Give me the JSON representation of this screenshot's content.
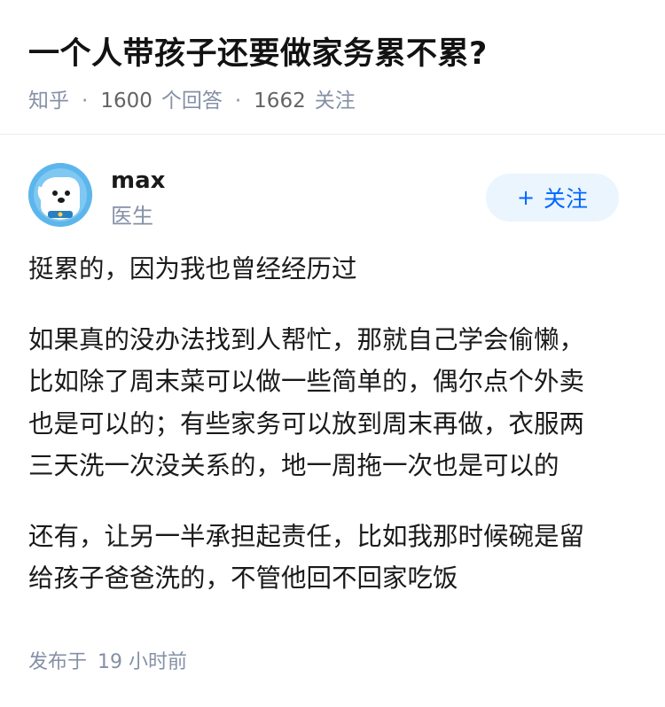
{
  "question": {
    "title": "一个人带孩子还要做家务累不累?",
    "source": "知乎",
    "separator": "·",
    "answer_count": "1600",
    "answer_label": "个回答",
    "follower_count": "1662",
    "follower_label": "关注"
  },
  "author": {
    "name": "max",
    "title": "医生",
    "avatar_icon": "dog-avatar-icon",
    "follow_plus": "+",
    "follow_label": "关注"
  },
  "answer": {
    "paragraphs": [
      [
        "挺累的，因为我也曾经经历过"
      ],
      [
        "如果真的没办法找到人帮忙，那就自己学会偷懒，",
        "比如除了周末菜可以做一些简单的，偶尔点个外卖",
        "也是可以的；有些家务可以放到周末再做，衣服两",
        "三天洗一次没关系的，地一周拖一次也是可以的"
      ],
      [
        "还有，让另一半承担起责任，比如我那时候碗是留",
        "给孩子爸爸洗的，不管他回不回家吃饭"
      ]
    ]
  },
  "footer": {
    "publish_label": "发布于",
    "publish_time": "19 小时前"
  },
  "colors": {
    "accent": "#0066ff",
    "follow_bg": "#ebf5fd",
    "meta_gray": "#8590a6",
    "avatar_bg": "#5cb6ec"
  }
}
